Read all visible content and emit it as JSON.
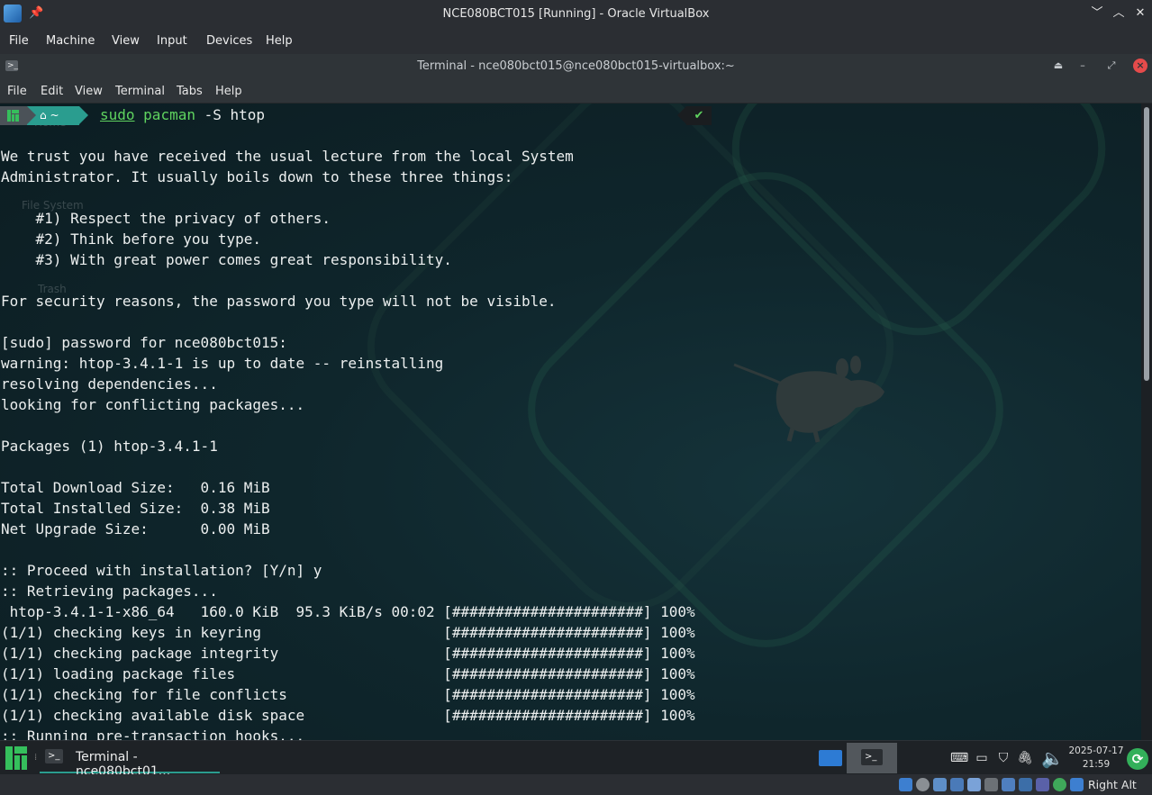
{
  "vbox": {
    "title": "NCE080BCT015 [Running] - Oracle VirtualBox",
    "menu": [
      "File",
      "Machine",
      "View",
      "Input",
      "Devices",
      "Help"
    ],
    "host_key": "Right Alt"
  },
  "terminal": {
    "title": "Terminal - nce080bct015@nce080bct015-virtualbox:~",
    "menu": [
      "File",
      "Edit",
      "View",
      "Terminal",
      "Tabs",
      "Help"
    ],
    "prompt_dir": "~",
    "command": {
      "sudo": "sudo",
      "pacman": "pacman",
      "args": " -S htop"
    },
    "status_mark": "✔",
    "lines": [
      "",
      "We trust you have received the usual lecture from the local System",
      "Administrator. It usually boils down to these three things:",
      "",
      "    #1) Respect the privacy of others.",
      "    #2) Think before you type.",
      "    #3) With great power comes great responsibility.",
      "",
      "For security reasons, the password you type will not be visible.",
      "",
      "[sudo] password for nce080bct015:",
      "warning: htop-3.4.1-1 is up to date -- reinstalling",
      "resolving dependencies...",
      "looking for conflicting packages...",
      "",
      "Packages (1) htop-3.4.1-1",
      "",
      "Total Download Size:   0.16 MiB",
      "Total Installed Size:  0.38 MiB",
      "Net Upgrade Size:      0.00 MiB",
      "",
      ":: Proceed with installation? [Y/n] y",
      ":: Retrieving packages...",
      " htop-3.4.1-1-x86_64   160.0 KiB  95.3 KiB/s 00:02 [######################] 100%",
      "(1/1) checking keys in keyring                     [######################] 100%",
      "(1/1) checking package integrity                   [######################] 100%",
      "(1/1) loading package files                        [######################] 100%",
      "(1/1) checking for file conflicts                  [######################] 100%",
      "(1/1) checking available disk space                [######################] 100%",
      ":: Running pre-transaction hooks..."
    ]
  },
  "desktop_ghost": [
    "Home",
    "File System",
    "Trash"
  ],
  "taskbar": {
    "task_label": "Terminal - nce080bct01...",
    "date": "2025-07-17",
    "time": "21:59"
  },
  "colors": {
    "accent": "#2a9d8f",
    "prompt_green": "#5fd35f",
    "terminal_bg": "#0f262c"
  }
}
